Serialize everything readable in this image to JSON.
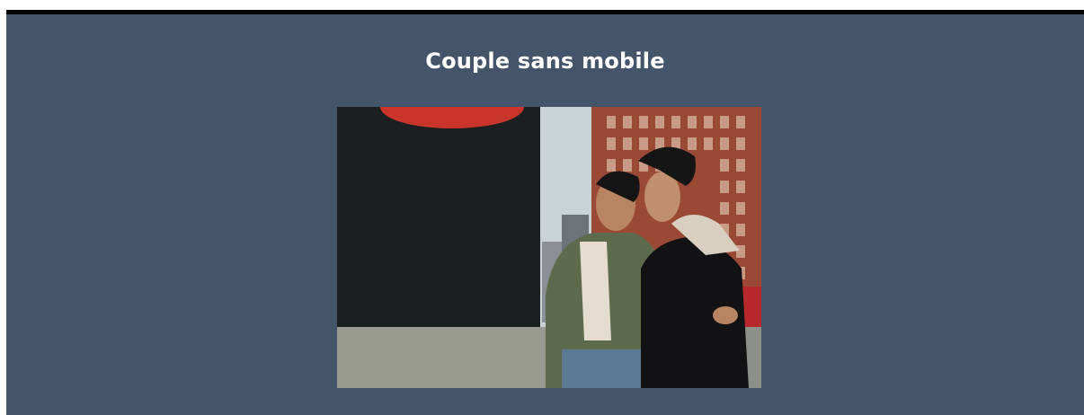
{
  "page": {
    "title": "Couple sans mobile"
  },
  "image": {
    "description_icon": "photo-icon"
  },
  "colors": {
    "background": "#455569",
    "top_border": "#000000",
    "title_text": "#ffffff"
  }
}
